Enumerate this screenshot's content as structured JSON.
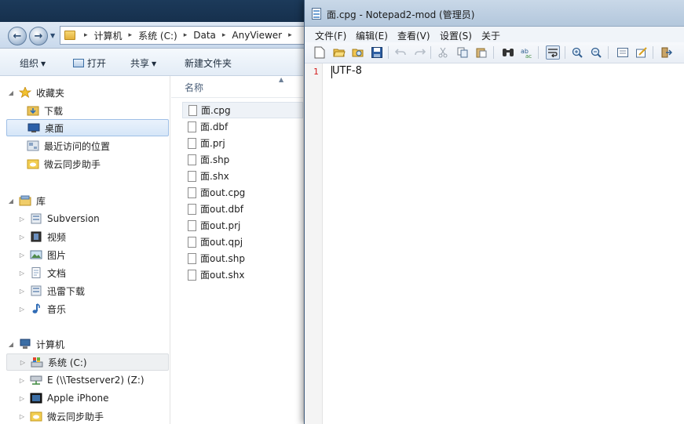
{
  "explorer": {
    "breadcrumbs": [
      "计算机",
      "系统 (C:)",
      "Data",
      "AnyViewer"
    ],
    "toolbar": {
      "organize": "组织",
      "open": "打开",
      "share": "共享",
      "new_folder": "新建文件夹"
    },
    "nav": {
      "favorites": {
        "label": "收藏夹",
        "items": [
          {
            "label": "下载",
            "icon": "download-folder-icon"
          },
          {
            "label": "桌面",
            "icon": "desktop-icon"
          },
          {
            "label": "最近访问的位置",
            "icon": "recent-places-icon"
          },
          {
            "label": "微云同步助手",
            "icon": "weiyun-icon"
          }
        ]
      },
      "libraries": {
        "label": "库",
        "items": [
          {
            "label": "Subversion",
            "icon": "library-icon"
          },
          {
            "label": "视频",
            "icon": "video-icon"
          },
          {
            "label": "图片",
            "icon": "pictures-icon"
          },
          {
            "label": "文档",
            "icon": "documents-icon"
          },
          {
            "label": "迅雷下载",
            "icon": "library-icon"
          },
          {
            "label": "音乐",
            "icon": "music-icon"
          }
        ]
      },
      "computer": {
        "label": "计算机",
        "items": [
          {
            "label": "系统 (C:)",
            "icon": "drive-icon"
          },
          {
            "label": "E (\\\\Testserver2) (Z:)",
            "icon": "network-drive-icon"
          },
          {
            "label": "Apple iPhone",
            "icon": "phone-icon"
          },
          {
            "label": "微云同步助手",
            "icon": "weiyun-icon"
          }
        ]
      }
    },
    "file_list": {
      "column_name": "名称",
      "files": [
        "面.cpg",
        "面.dbf",
        "面.prj",
        "面.shp",
        "面.shx",
        "面out.cpg",
        "面out.dbf",
        "面out.prj",
        "面out.qpj",
        "面out.shp",
        "面out.shx"
      ]
    }
  },
  "notepad": {
    "title": "面.cpg - Notepad2-mod (管理员)",
    "menu": [
      "文件(F)",
      "编辑(E)",
      "查看(V)",
      "设置(S)",
      "关于"
    ],
    "content": {
      "line_number": "1",
      "line_text": "UTF-8"
    }
  },
  "colors": {
    "accent": "#3b6ea5",
    "line_number": "#d31c1c",
    "selection": "#d6e6f8"
  }
}
